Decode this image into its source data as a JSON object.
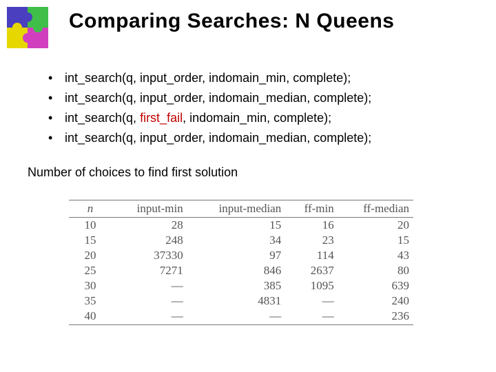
{
  "title": "Comparing Searches: N Queens",
  "bullets": [
    {
      "prefix": "int_search(q, input_order, indomain_min, complete);",
      "ff": false
    },
    {
      "prefix": "int_search(q, input_order, indomain_median, complete);",
      "ff": false
    },
    {
      "prefix": "int_search(q, ",
      "ff_text": "first_fail",
      "suffix": ", indomain_min, complete);",
      "ff": true
    },
    {
      "prefix": "int_search(q, input_order, indomain_median, complete);",
      "ff": false
    }
  ],
  "subhead": "Number of choices to find first solution",
  "chart_data": {
    "type": "table",
    "columns": [
      "n",
      "input-min",
      "input-median",
      "ff-min",
      "ff-median"
    ],
    "rows": [
      {
        "n": "10",
        "input_min": "28",
        "input_median": "15",
        "ff_min": "16",
        "ff_median": "20"
      },
      {
        "n": "15",
        "input_min": "248",
        "input_median": "34",
        "ff_min": "23",
        "ff_median": "15"
      },
      {
        "n": "20",
        "input_min": "37330",
        "input_median": "97",
        "ff_min": "114",
        "ff_median": "43"
      },
      {
        "n": "25",
        "input_min": "7271",
        "input_median": "846",
        "ff_min": "2637",
        "ff_median": "80"
      },
      {
        "n": "30",
        "input_min": "—",
        "input_median": "385",
        "ff_min": "1095",
        "ff_median": "639"
      },
      {
        "n": "35",
        "input_min": "—",
        "input_median": "4831",
        "ff_min": "—",
        "ff_median": "240"
      },
      {
        "n": "40",
        "input_min": "—",
        "input_median": "—",
        "ff_min": "—",
        "ff_median": "236"
      }
    ]
  }
}
